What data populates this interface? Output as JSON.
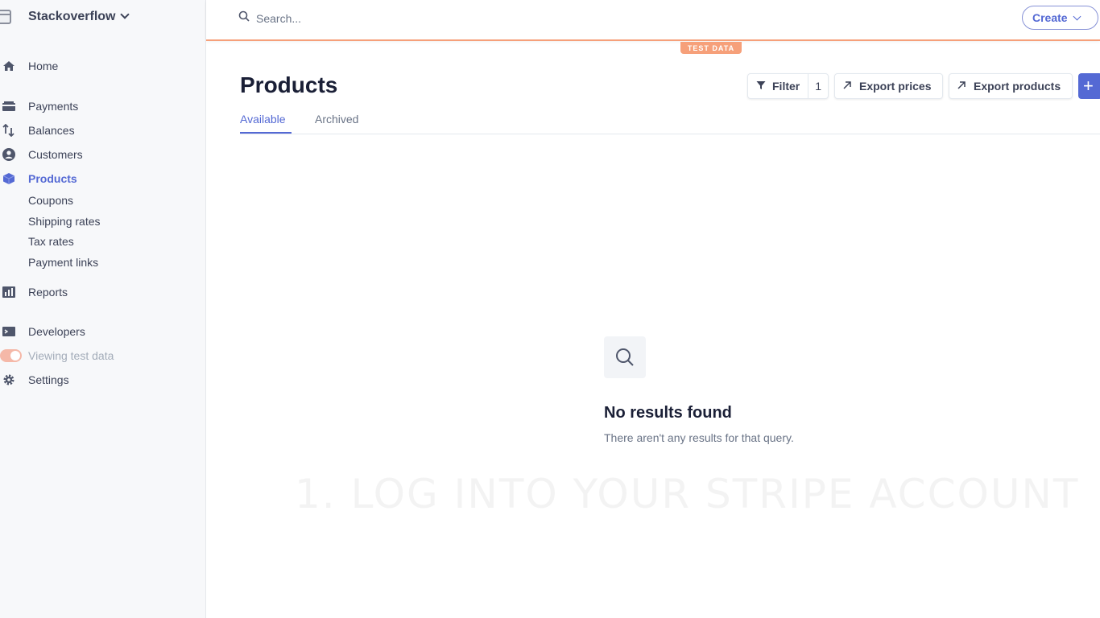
{
  "account": {
    "name": "Stackoverflow"
  },
  "search": {
    "placeholder": "Search..."
  },
  "topbar": {
    "create_label": "Create",
    "test_badge": "TEST DATA"
  },
  "sidebar": {
    "home": "Home",
    "payments": "Payments",
    "balances": "Balances",
    "customers": "Customers",
    "products": "Products",
    "sub_items": [
      "Coupons",
      "Shipping rates",
      "Tax rates",
      "Payment links"
    ],
    "reports": "Reports",
    "developers": "Developers",
    "viewing_test_data": "Viewing test data",
    "settings": "Settings"
  },
  "page": {
    "title": "Products",
    "tabs": [
      "Available",
      "Archived"
    ],
    "filter_label": "Filter",
    "filter_count": "1",
    "export_prices": "Export prices",
    "export_products": "Export products",
    "add_label": "+"
  },
  "empty": {
    "title": "No results found",
    "subtitle": "There aren't any results for that query."
  },
  "overlay": {
    "caption": "1. LOG INTO YOUR STRIPE ACCOUNT"
  },
  "colors": {
    "accent": "#5469d4",
    "test_mode": "#f6a07a",
    "sidebar_bg": "#f7f8fa"
  }
}
